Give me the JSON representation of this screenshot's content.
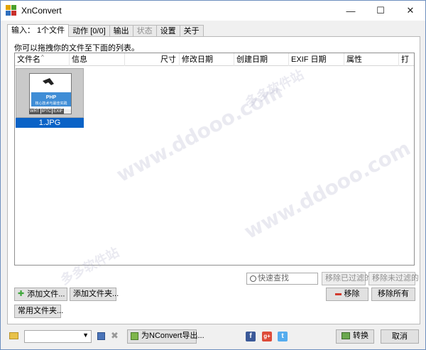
{
  "window": {
    "title": "XnConvert",
    "controls": {
      "minimize": "—",
      "maximize": "☐",
      "close": "✕"
    }
  },
  "tabs": [
    {
      "label": "输入：  1个文件",
      "state": "active"
    },
    {
      "label": "动作 [0/0]",
      "state": "normal"
    },
    {
      "label": "输出",
      "state": "normal"
    },
    {
      "label": "状态",
      "state": "disabled"
    },
    {
      "label": "设置",
      "state": "normal"
    },
    {
      "label": "关于",
      "state": "normal"
    }
  ],
  "input_panel": {
    "hint": "你可以拖拽你的文件至下面的列表。",
    "columns": [
      "文件名",
      "信息",
      "尺寸",
      "修改日期",
      "创建日期",
      "EXIF 日期",
      "属性",
      "打"
    ],
    "files": [
      {
        "name": "1.JPG",
        "selected": true,
        "thumb_title": "PHP",
        "thumb_subtitle": "核心技术与最佳实践",
        "thumb_badges": [
          "WRT",
          "IPTC",
          "EXIF"
        ]
      }
    ],
    "search_placeholder": "快速查找",
    "remove_filtered_label": "移除已过滤的",
    "remove_unfiltered_label": "移除未过滤的",
    "add_files_label": "添加文件...",
    "add_folder_label": "添加文件夹...",
    "remove_label": "移除",
    "remove_all_label": "移除所有",
    "common_folders_label": "常用文件夹..."
  },
  "footer": {
    "preset_value": "",
    "export_label": "为NConvert导出...",
    "convert_label": "转换",
    "cancel_label": "取消",
    "social": [
      "f",
      "g+",
      "t"
    ]
  },
  "watermark": {
    "domain": "www.ddooo.com",
    "site": "多多软件站"
  },
  "colors": {
    "selection": "#0a62c6",
    "add_icon": "#3ea63a",
    "remove_icon": "#d23a2e",
    "facebook": "#3b5998",
    "google": "#dd4b39",
    "twitter": "#55acee",
    "folder": "#e8c24a"
  }
}
